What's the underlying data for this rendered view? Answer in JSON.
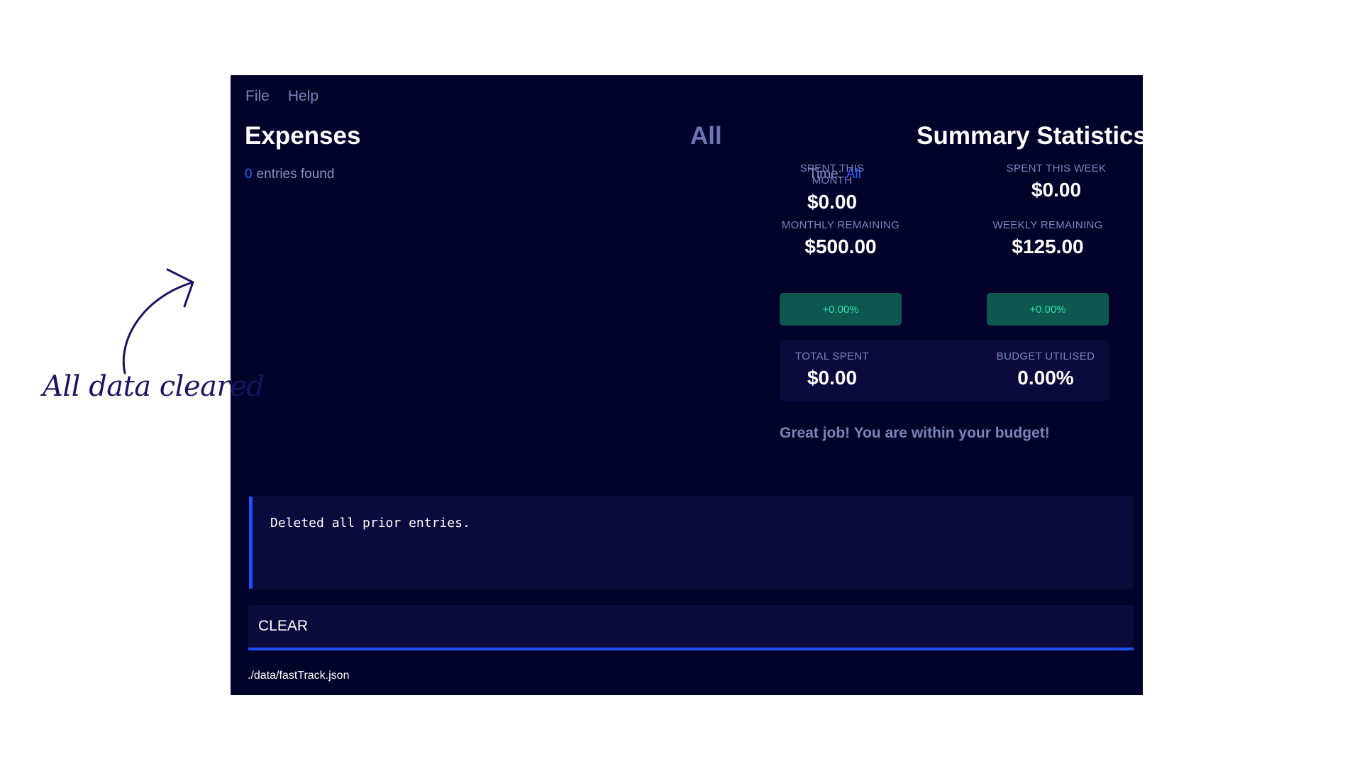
{
  "menu": {
    "file": "File",
    "help": "Help"
  },
  "expenses": {
    "title": "Expenses",
    "filter": "All",
    "count": "0",
    "count_suffix": "entries found",
    "time_label": "Time:",
    "time_value": "All"
  },
  "summary": {
    "title": "Summary Statistics",
    "spent_month": {
      "label": "SPENT THIS MONTH",
      "value": "$0.00"
    },
    "spent_week": {
      "label": "SPENT THIS WEEK",
      "value": "$0.00"
    },
    "monthly_remaining": {
      "label": "MONTHLY REMAINING",
      "value": "$500.00"
    },
    "weekly_remaining": {
      "label": "WEEKLY REMAINING",
      "value": "$125.00"
    },
    "monthly_change": "+0.00%",
    "weekly_change": "+0.00%",
    "total_spent": {
      "label": "TOTAL SPENT",
      "value": "$0.00"
    },
    "budget_utilised": {
      "label": "BUDGET UTILISED",
      "value": "0.00%"
    },
    "message": "Great job! You are within your budget!"
  },
  "result": {
    "text": "Deleted all prior entries."
  },
  "command": {
    "value": "CLEAR"
  },
  "status": {
    "path": "./data/fastTrack.json"
  },
  "annotation": {
    "text": "All data cleared"
  },
  "icons": {
    "annotation_arrow": "curved-arrow-icon"
  },
  "colors": {
    "background": "#03022a",
    "panel": "#0c0a3c",
    "accent": "#1d4fff",
    "positive": "#2be3a4",
    "muted": "#7d84b9",
    "annotation": "#1b1464"
  }
}
